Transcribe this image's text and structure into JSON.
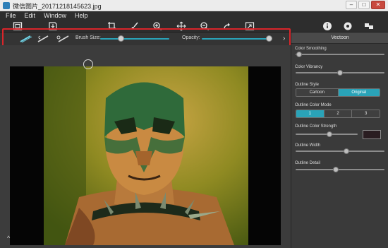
{
  "window": {
    "title": "微信图片_20171218145623.jpg",
    "controls": [
      "minimize",
      "maximize",
      "close"
    ]
  },
  "menu": [
    "File",
    "Edit",
    "Window",
    "Help"
  ],
  "toolbar": {
    "left_icons": [
      "fit-screen-icon",
      "save-icon"
    ],
    "center_icons": [
      "crop-icon",
      "brush-icon",
      "zoom-in-icon",
      "move-icon",
      "zoom-out-icon",
      "redo-icon",
      "export-icon"
    ],
    "right_icons": [
      "info-icon",
      "settings-icon",
      "share-icon"
    ]
  },
  "brush_bar": {
    "tools": [
      "brush-tool-1-icon",
      "brush-tool-2-icon",
      "brush-tool-3-icon"
    ],
    "brush_size_label": "Brush Size:",
    "brush_size_value": 0.3,
    "opacity_label": "Opacity:",
    "opacity_value": 0.95
  },
  "panel": {
    "tab": "Vectoon",
    "color_smoothing": {
      "label": "Color Smoothing",
      "value": 0.04
    },
    "color_vibrancy": {
      "label": "Color Vibrancy",
      "value": 0.5
    },
    "outline_style": {
      "label": "Outline Style",
      "options": [
        "Cartoon",
        "Original"
      ],
      "selected": "Original"
    },
    "outline_color_mode": {
      "label": "Outline Color Mode",
      "options": [
        "1",
        "2",
        "3"
      ],
      "selected": "1"
    },
    "outline_color_strength": {
      "label": "Outline Color Strength",
      "value": 0.55
    },
    "outline_width": {
      "label": "Outline Width",
      "value": 0.57
    },
    "outline_detail": {
      "label": "Outline Detail",
      "value": 0.45
    }
  }
}
